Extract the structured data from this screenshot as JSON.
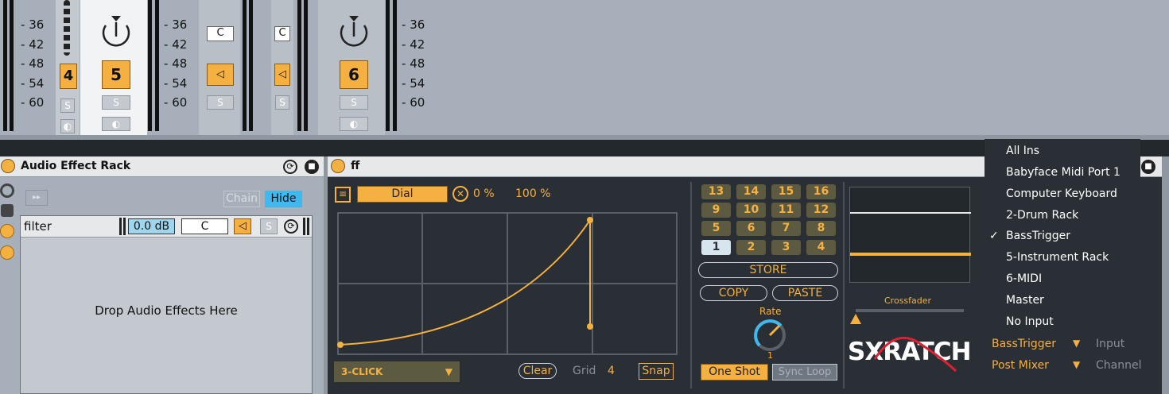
{
  "mixer": {
    "scale_values": [
      "36",
      "42",
      "48",
      "54",
      "60"
    ],
    "track4_number": "4",
    "track5_number": "5",
    "track6_number": "6",
    "solo_label": "S",
    "c_label": "C"
  },
  "rack": {
    "title": "Audio Effect Rack",
    "chain_label": "Chain",
    "hide_label": "Hide",
    "chain_name": "filter",
    "chain_volume": "0.0 dB",
    "chain_pan": "C",
    "drop_hint": "Drop Audio Effects Here"
  },
  "device": {
    "title": "ff",
    "mode_label": "Dial",
    "min_percent": "0 %",
    "max_percent": "100 %",
    "preset_name": "3-CLICK",
    "clear_label": "Clear",
    "grid_label": "Grid",
    "grid_value": "4",
    "snap_label": "Snap",
    "pads": [
      "13",
      "14",
      "15",
      "16",
      "9",
      "10",
      "11",
      "12",
      "5",
      "6",
      "7",
      "8",
      "1",
      "2",
      "3",
      "4"
    ],
    "store_label": "STORE",
    "copy_label": "COPY",
    "paste_label": "PASTE",
    "rate_label": "Rate",
    "rate_value": "1",
    "oneshot_label": "One Shot",
    "syncloop_label": "Sync Loop",
    "crossfader_label": "Crossfader",
    "logo_text": "SXRATCH",
    "input_value": "BassTrigger",
    "input_label": "Input",
    "channel_value": "Post Mixer",
    "channel_label": "Channel"
  },
  "input_menu": {
    "items": [
      "All Ins",
      "Babyface Midi Port 1",
      "Computer Keyboard",
      "2-Drum Rack",
      "BassTrigger",
      "5-Instrument Rack",
      "6-MIDI",
      "Master",
      "No Input"
    ],
    "checked": "BassTrigger",
    "check_mark": "✓"
  },
  "colors": {
    "accent": "#f5b042",
    "device_bg": "#2a2f35",
    "panel_bg": "#a7b0ba",
    "hide_blue": "#3fb8f0"
  }
}
